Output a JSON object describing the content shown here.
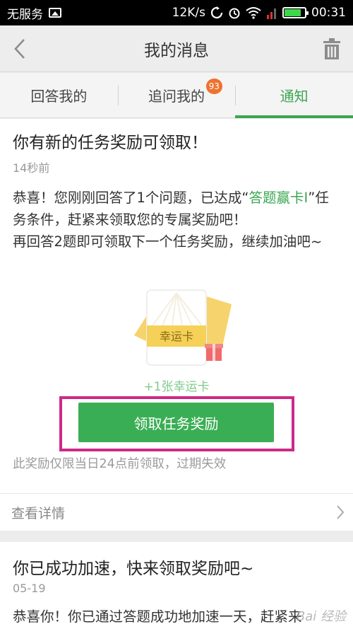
{
  "status_bar": {
    "carrier": "无服务",
    "speed": "12K/s",
    "time": "00:31"
  },
  "nav": {
    "title": "我的消息",
    "back_icon": "chevron-left-icon",
    "trash_icon": "trash-icon"
  },
  "tabs": [
    {
      "label": "回答我的",
      "active": false
    },
    {
      "label": "追问我的",
      "active": false,
      "badge": "93"
    },
    {
      "label": "通知",
      "active": true
    }
  ],
  "messages": [
    {
      "title": "你有新的任务奖励可领取！",
      "time": "14秒前",
      "body_prefix": "恭喜！您刚刚回答了1个问题，已达成“",
      "body_highlight": "答题赢卡Ⅰ",
      "body_suffix": "”任务条件，赶紧来领取您的专属奖励吧！",
      "body_line2": "再回答2题即可领取下一个任务奖励，继续加油吧~",
      "card_label": "幸运卡",
      "reward_text": "+1张幸运卡",
      "button_label": "领取任务奖励",
      "note": "此奖励仅限当日24点前领取，过期失效",
      "detail_link": "查看详情"
    },
    {
      "title": "你已成功加速，快来领取奖励吧~",
      "time": "05-19",
      "body": "恭喜你！你已通过答题成功地加速一天，赶紧来"
    }
  ],
  "colors": {
    "accent": "#3aa650",
    "button": "#3aae54",
    "badge": "#ee7230",
    "highlight_frame": "#cc2a86"
  }
}
